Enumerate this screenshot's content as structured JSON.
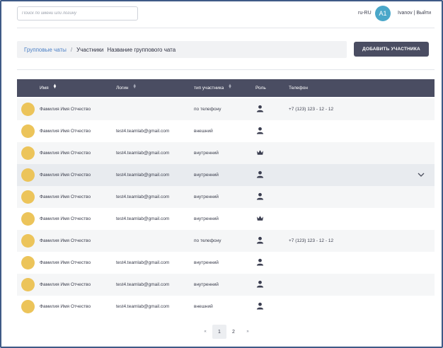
{
  "header": {
    "search_placeholder": "Поиск по имени или логину",
    "language": "ru-RU",
    "avatar_initials": "A1",
    "user_links": "Ivanov | Выйти"
  },
  "breadcrumb": {
    "parent": "Групповые чаты",
    "separator": "/",
    "current": "Участники",
    "chat_name": "Название группового чата"
  },
  "add_button_label": "ДОБАВИТЬ УЧАСТНИКА",
  "table": {
    "columns": {
      "name": "Имя",
      "login": "Логин",
      "type": "тип участника",
      "role": "Роль",
      "phone": "Телефон"
    },
    "rows": [
      {
        "name": "Фамилия Имя Отчество",
        "login": "",
        "type": "по телефону",
        "role": "user",
        "phone": "+7 (123) 123 - 12 - 12"
      },
      {
        "name": "Фамилия Имя Отчество",
        "login": "test4.teamlab@gmail.com",
        "type": "внешний",
        "role": "user",
        "phone": ""
      },
      {
        "name": "Фамилия Имя Отчество",
        "login": "test4.teamlab@gmail.com",
        "type": "внутренний",
        "role": "admin",
        "phone": ""
      },
      {
        "name": "Фамилия Имя Отчество",
        "login": "test4.teamlab@gmail.com",
        "type": "внутренний",
        "role": "user",
        "phone": ""
      },
      {
        "name": "Фамилия Имя Отчество",
        "login": "test4.teamlab@gmail.com",
        "type": "внутренний",
        "role": "user",
        "phone": ""
      },
      {
        "name": "Фамилия Имя Отчество",
        "login": "test4.teamlab@gmail.com",
        "type": "внутренний",
        "role": "admin",
        "phone": ""
      },
      {
        "name": "Фамилия Имя Отчество",
        "login": "",
        "type": "по телефону",
        "role": "user",
        "phone": "+7 (123) 123 - 12 - 12"
      },
      {
        "name": "Фамилия Имя Отчество",
        "login": "test4.teamlab@gmail.com",
        "type": "внутренний",
        "role": "user",
        "phone": ""
      },
      {
        "name": "Фамилия Имя Отчество",
        "login": "test4.teamlab@gmail.com",
        "type": "внутренний",
        "role": "user",
        "phone": ""
      },
      {
        "name": "Фамилия Имя Отчество",
        "login": "test4.teamlab@gmail.com",
        "type": "внешний",
        "role": "user",
        "phone": ""
      }
    ]
  },
  "pagination": {
    "prev": "«",
    "pages": [
      "1",
      "2"
    ],
    "next": "»"
  },
  "colors": {
    "header_bg": "#4a4d62",
    "avatar_fill": "#ecc45a",
    "link": "#4a7fc6",
    "accent_avatar": "#4aa7c9"
  }
}
